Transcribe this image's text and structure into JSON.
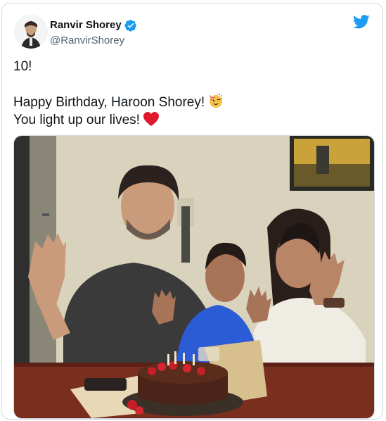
{
  "author": {
    "name": "Ranvir Shorey",
    "handle": "@RanvirShorey",
    "verified": true,
    "avatar_icon": "avatar-portrait"
  },
  "brand": {
    "icon": "twitter-bird-icon",
    "color": "#1d9bf0"
  },
  "tweet": {
    "line1": "10!",
    "line2": "Happy Birthday, Haroon Shorey!",
    "line2_emoji": "partying-face-emoji",
    "line3": "You light up our lives!",
    "line3_emoji": "red-heart-emoji"
  },
  "media": {
    "type": "photo",
    "scene": "family-birthday-with-chocolate-cake",
    "colors": {
      "wall": "#d8d0b8",
      "table": "#7a2e1e",
      "cake": "#4a2418",
      "boy_shirt": "#2c5bd6"
    }
  }
}
